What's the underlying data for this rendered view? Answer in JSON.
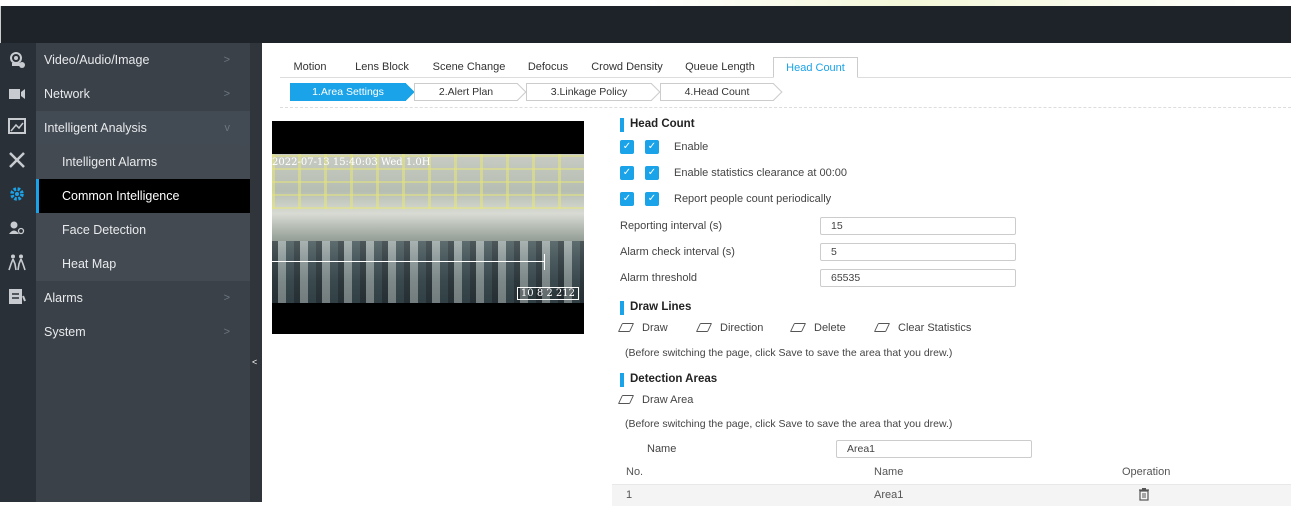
{
  "sidebar": {
    "items": [
      {
        "label": "Video/Audio/Image",
        "arrow": ">"
      },
      {
        "label": "Network",
        "arrow": ">"
      },
      {
        "label": "Intelligent Analysis",
        "arrow": "v"
      },
      {
        "label": "Intelligent Alarms"
      },
      {
        "label": "Common Intelligence"
      },
      {
        "label": "Face Detection"
      },
      {
        "label": "Heat Map"
      },
      {
        "label": "Alarms",
        "arrow": ">"
      },
      {
        "label": "System",
        "arrow": ">"
      }
    ],
    "collapse_handle": "<"
  },
  "icons": [
    "camera-settings-icon",
    "video-icon",
    "image-icon",
    "tools-icon",
    "gear-icon",
    "face-search-icon",
    "people-icon",
    "checklist-icon"
  ],
  "tabs": [
    "Motion",
    "Lens Block",
    "Scene Change",
    "Defocus",
    "Crowd Density",
    "Queue Length",
    "Head Count"
  ],
  "steps": [
    "1.Area Settings",
    "2.Alert Plan",
    "3.Linkage Policy",
    "4.Head Count"
  ],
  "video": {
    "osd_top": "2022-07-13 15:40:03  Wed 1.0H",
    "osd_bottom": "10 8  2 212"
  },
  "head_count": {
    "title": "Head Count",
    "enable": "Enable",
    "clearance": "Enable statistics clearance at 00:00",
    "report": "Report people count periodically",
    "reporting_interval_label": "Reporting interval (s)",
    "reporting_interval": "15",
    "alarm_check_label": "Alarm check interval (s)",
    "alarm_check": "5",
    "alarm_threshold_label": "Alarm threshold",
    "alarm_threshold": "65535"
  },
  "draw_lines": {
    "title": "Draw Lines",
    "tools": [
      "Draw",
      "Direction",
      "Delete",
      "Clear Statistics"
    ],
    "note": "(Before switching the page, click Save to save the area that you drew.)"
  },
  "detection_areas": {
    "title": "Detection Areas",
    "draw_area": "Draw Area",
    "note": "(Before switching the page, click Save to save the area that you drew.)",
    "name_label": "Name",
    "name_value": "Area1",
    "columns": [
      "No.",
      "Name",
      "Operation"
    ],
    "rows": [
      {
        "no": "1",
        "name": "Area1"
      }
    ]
  },
  "colors": {
    "accent": "#1aa3e8",
    "sidebar": "#3a4149",
    "topbar": "#1d2329"
  }
}
